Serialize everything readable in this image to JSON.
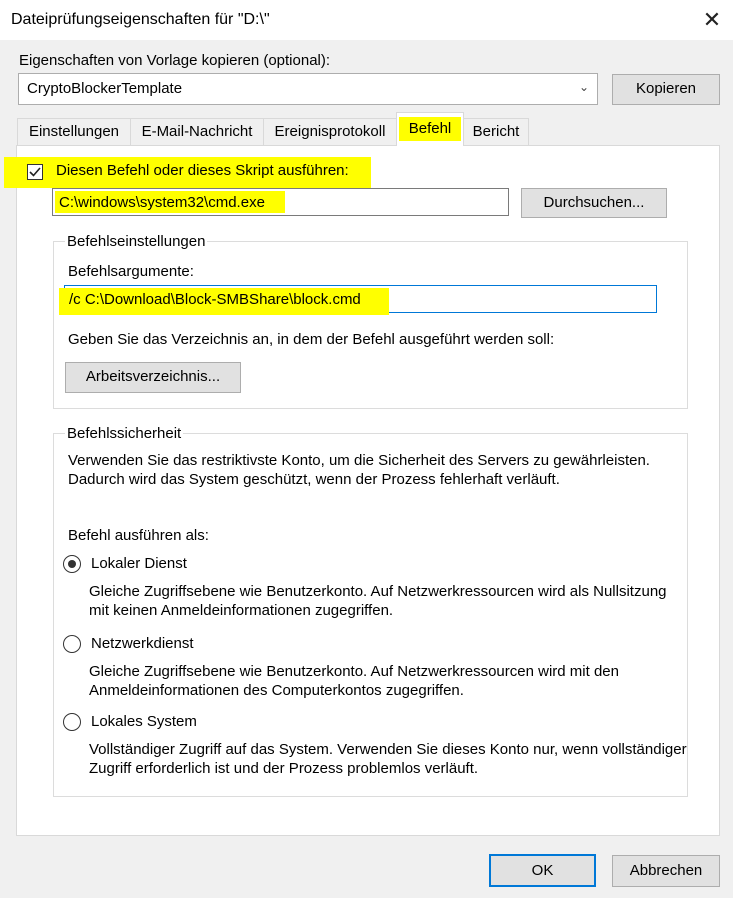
{
  "window": {
    "title": "Dateiprüfungseigenschaften für \"D:\\\"",
    "close_glyph": "✕"
  },
  "template": {
    "label": "Eigenschaften von Vorlage kopieren (optional):",
    "selected": "CryptoBlockerTemplate",
    "copy_button": "Kopieren"
  },
  "tabs": [
    {
      "label": "Einstellungen",
      "active": false
    },
    {
      "label": "E-Mail-Nachricht",
      "active": false
    },
    {
      "label": "Ereignisprotokoll",
      "active": false
    },
    {
      "label": "Befehl",
      "active": true
    },
    {
      "label": "Bericht",
      "active": false
    }
  ],
  "command": {
    "run_checkbox_label": "Diesen Befehl oder dieses Skript ausführen:",
    "run_checked": true,
    "path_value": "C:\\windows\\system32\\cmd.exe",
    "browse_button": "Durchsuchen...",
    "settings_group_title": "Befehlseinstellungen",
    "args_label": "Befehlsargumente:",
    "args_value": "/c C:\\Download\\Block-SMBShare\\block.cmd",
    "workdir_prompt": "Geben Sie das Verzeichnis an, in dem der Befehl ausgeführt werden soll:",
    "workdir_button": "Arbeitsverzeichnis..."
  },
  "security": {
    "group_title": "Befehlssicherheit",
    "description": "Verwenden Sie das restriktivste Konto, um die Sicherheit des Servers zu gewährleisten. Dadurch wird das System geschützt, wenn der Prozess fehlerhaft verläuft.",
    "run_as_label": "Befehl ausführen als:",
    "options": [
      {
        "label": "Lokaler Dienst",
        "selected": true,
        "description": "Gleiche Zugriffsebene wie Benutzerkonto. Auf Netzwerkressourcen wird als Nullsitzung mit keinen Anmeldeinformationen zugegriffen."
      },
      {
        "label": "Netzwerkdienst",
        "selected": false,
        "description": "Gleiche Zugriffsebene wie Benutzerkonto. Auf Netzwerkressourcen wird mit den Anmeldeinformationen des Computerkontos zugegriffen."
      },
      {
        "label": "Lokales System",
        "selected": false,
        "description": "Vollständiger Zugriff auf das System. Verwenden Sie dieses Konto nur, wenn vollständiger Zugriff erforderlich ist und der Prozess problemlos verläuft."
      }
    ]
  },
  "footer": {
    "ok_button": "OK",
    "cancel_button": "Abbrechen"
  },
  "colors": {
    "highlight": "#ffff00",
    "focus_border": "#0078d7",
    "dialog_bg": "#f0f0f0"
  }
}
